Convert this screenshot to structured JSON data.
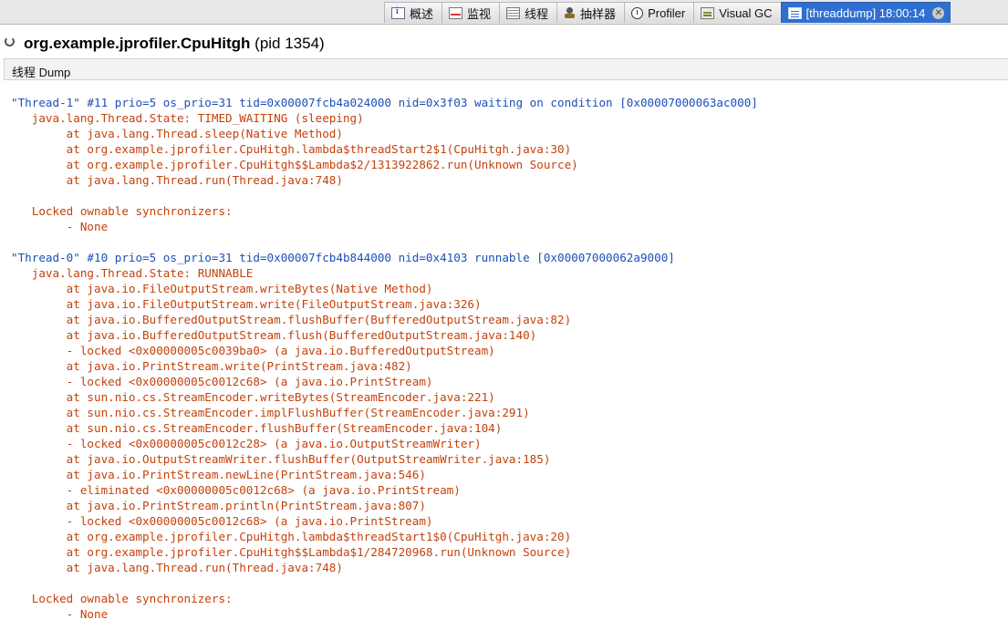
{
  "tabs": [
    {
      "label": "概述",
      "icon": "overview-icon"
    },
    {
      "label": "监视",
      "icon": "monitor-icon"
    },
    {
      "label": "线程",
      "icon": "threads-icon"
    },
    {
      "label": "抽样器",
      "icon": "sampler-icon"
    },
    {
      "label": "Profiler",
      "icon": "profiler-icon"
    },
    {
      "label": "Visual GC",
      "icon": "visual-gc-icon"
    },
    {
      "label": "[threaddump] 18:00:14",
      "icon": "thread-dump-icon",
      "active": true
    }
  ],
  "header": {
    "app_name": "org.example.jprofiler.CpuHitgh",
    "pid": "(pid 1354)"
  },
  "section_label": "线程 Dump",
  "colors": {
    "thread_header": "#1d4fb8",
    "stack_text": "#c4420c",
    "active_tab": "#2f6fd0"
  },
  "dump_lines": [
    {
      "text": "\"Thread-1\" #11 prio=5 os_prio=31 tid=0x00007fcb4a024000 nid=0x3f03 waiting on condition [0x00007000063ac000]",
      "kind": "hdr"
    },
    {
      "text": "   java.lang.Thread.State: TIMED_WAITING (sleeping)",
      "kind": "body"
    },
    {
      "text": "        at java.lang.Thread.sleep(Native Method)",
      "kind": "body"
    },
    {
      "text": "        at org.example.jprofiler.CpuHitgh.lambda$threadStart2$1(CpuHitgh.java:30)",
      "kind": "body"
    },
    {
      "text": "        at org.example.jprofiler.CpuHitgh$$Lambda$2/1313922862.run(Unknown Source)",
      "kind": "body"
    },
    {
      "text": "        at java.lang.Thread.run(Thread.java:748)",
      "kind": "body"
    },
    {
      "text": "",
      "kind": "body"
    },
    {
      "text": "   Locked ownable synchronizers:",
      "kind": "body"
    },
    {
      "text": "        - None",
      "kind": "body"
    },
    {
      "text": "",
      "kind": "body"
    },
    {
      "text": "\"Thread-0\" #10 prio=5 os_prio=31 tid=0x00007fcb4b844000 nid=0x4103 runnable [0x00007000062a9000]",
      "kind": "hdr"
    },
    {
      "text": "   java.lang.Thread.State: RUNNABLE",
      "kind": "body"
    },
    {
      "text": "        at java.io.FileOutputStream.writeBytes(Native Method)",
      "kind": "body"
    },
    {
      "text": "        at java.io.FileOutputStream.write(FileOutputStream.java:326)",
      "kind": "body"
    },
    {
      "text": "        at java.io.BufferedOutputStream.flushBuffer(BufferedOutputStream.java:82)",
      "kind": "body"
    },
    {
      "text": "        at java.io.BufferedOutputStream.flush(BufferedOutputStream.java:140)",
      "kind": "body"
    },
    {
      "text": "        - locked <0x00000005c0039ba0> (a java.io.BufferedOutputStream)",
      "kind": "body"
    },
    {
      "text": "        at java.io.PrintStream.write(PrintStream.java:482)",
      "kind": "body"
    },
    {
      "text": "        - locked <0x00000005c0012c68> (a java.io.PrintStream)",
      "kind": "body"
    },
    {
      "text": "        at sun.nio.cs.StreamEncoder.writeBytes(StreamEncoder.java:221)",
      "kind": "body"
    },
    {
      "text": "        at sun.nio.cs.StreamEncoder.implFlushBuffer(StreamEncoder.java:291)",
      "kind": "body"
    },
    {
      "text": "        at sun.nio.cs.StreamEncoder.flushBuffer(StreamEncoder.java:104)",
      "kind": "body"
    },
    {
      "text": "        - locked <0x00000005c0012c28> (a java.io.OutputStreamWriter)",
      "kind": "body"
    },
    {
      "text": "        at java.io.OutputStreamWriter.flushBuffer(OutputStreamWriter.java:185)",
      "kind": "body"
    },
    {
      "text": "        at java.io.PrintStream.newLine(PrintStream.java:546)",
      "kind": "body"
    },
    {
      "text": "        - eliminated <0x00000005c0012c68> (a java.io.PrintStream)",
      "kind": "body"
    },
    {
      "text": "        at java.io.PrintStream.println(PrintStream.java:807)",
      "kind": "body"
    },
    {
      "text": "        - locked <0x00000005c0012c68> (a java.io.PrintStream)",
      "kind": "body"
    },
    {
      "text": "        at org.example.jprofiler.CpuHitgh.lambda$threadStart1$0(CpuHitgh.java:20)",
      "kind": "body"
    },
    {
      "text": "        at org.example.jprofiler.CpuHitgh$$Lambda$1/284720968.run(Unknown Source)",
      "kind": "body"
    },
    {
      "text": "        at java.lang.Thread.run(Thread.java:748)",
      "kind": "body"
    },
    {
      "text": "",
      "kind": "body"
    },
    {
      "text": "   Locked ownable synchronizers:",
      "kind": "body"
    },
    {
      "text": "        - None",
      "kind": "body"
    }
  ]
}
